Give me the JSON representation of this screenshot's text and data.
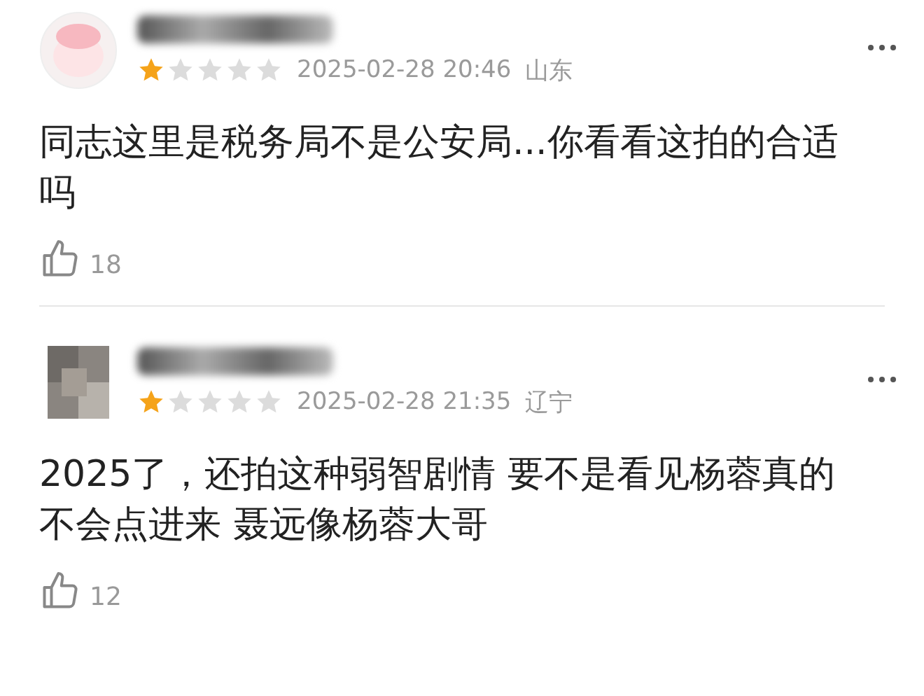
{
  "comments": [
    {
      "kind": "cartoon",
      "stars": 1,
      "date": "2025-02-28 20:46",
      "region": "山东",
      "text": "同志这里是税务局不是公安局...你看看这拍的合适吗",
      "likes": "18"
    },
    {
      "kind": "photo",
      "stars": 1,
      "date": "2025-02-28 21:35",
      "region": "辽宁",
      "text": "2025了，还拍这种弱智剧情 要不是看见杨蓉真的不会点进来 聂远像杨蓉大哥",
      "likes": "12"
    }
  ]
}
